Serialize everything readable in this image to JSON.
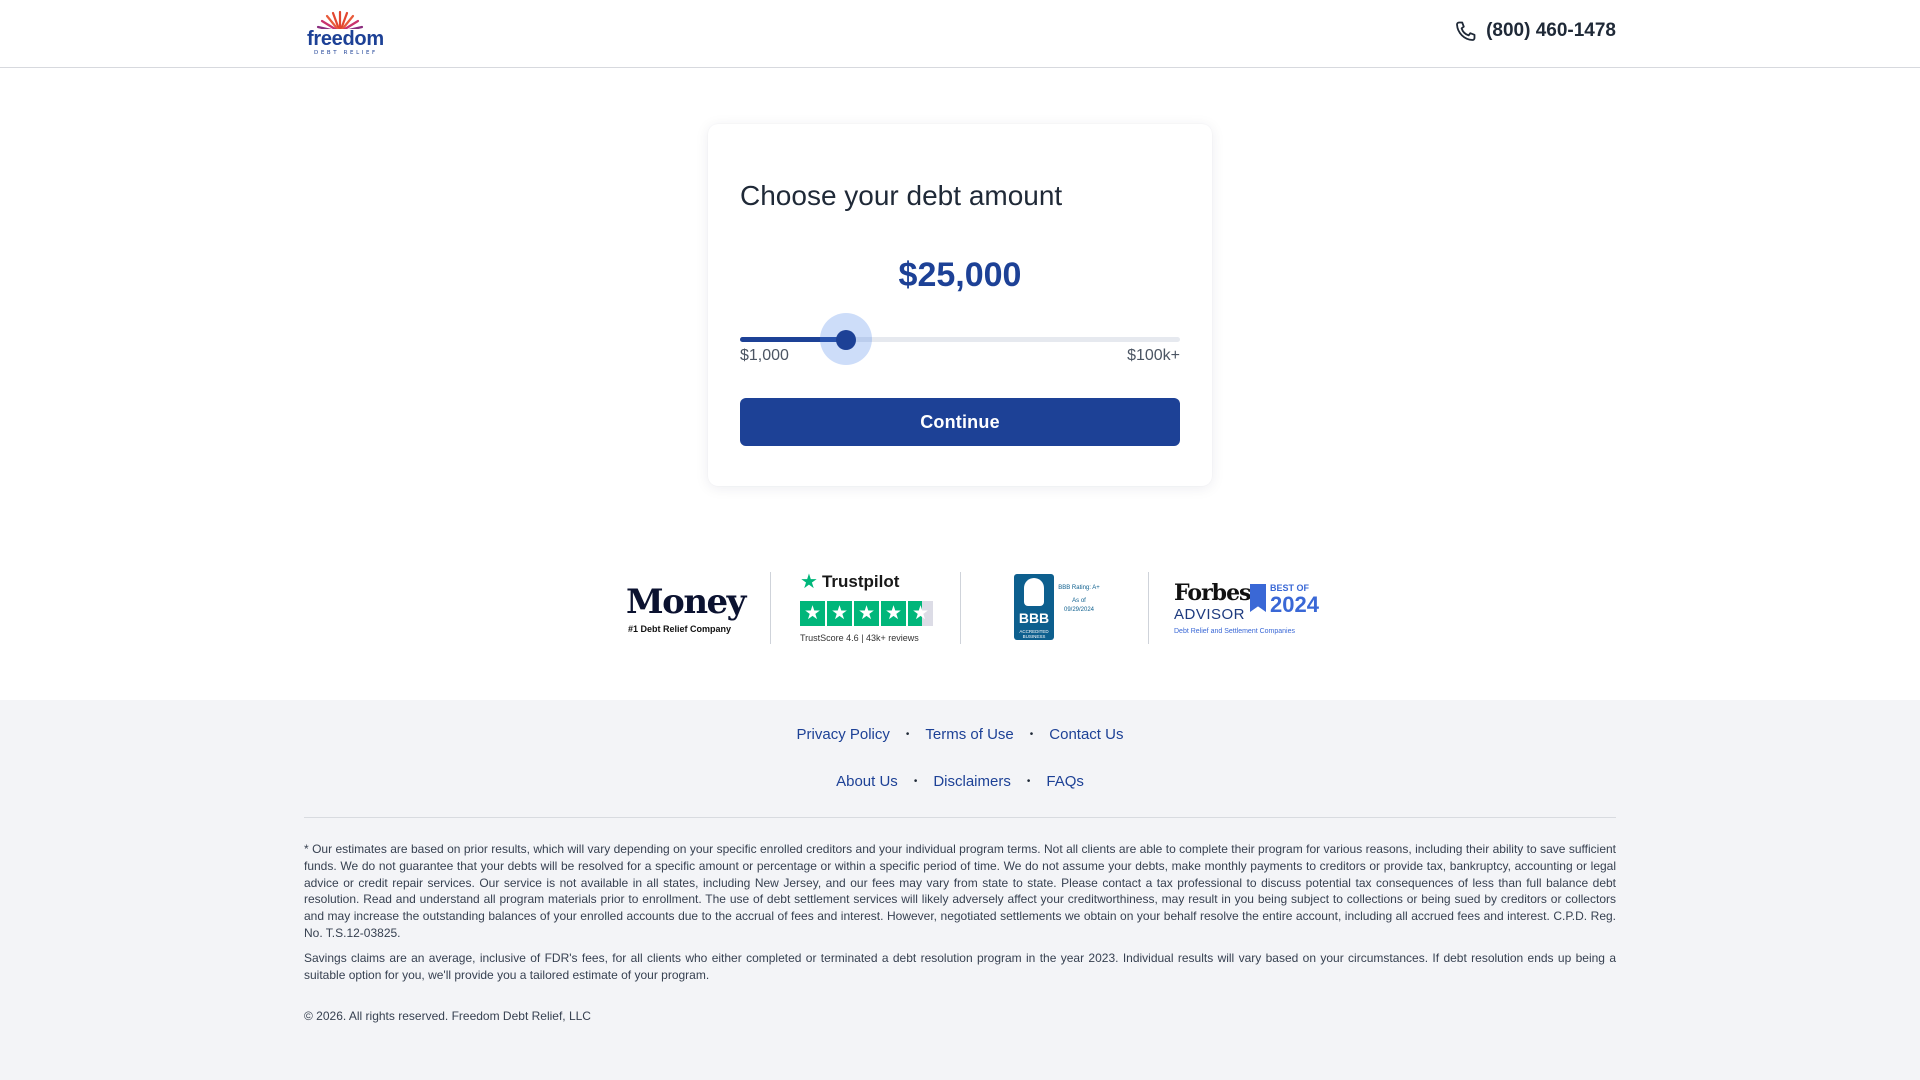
{
  "header": {
    "logo_word": "freedom",
    "logo_sub": "DEBT RELIEF",
    "phone": "(800) 460-1478"
  },
  "card": {
    "title": "Choose your debt amount",
    "amount_display": "$25,000",
    "slider": {
      "min_label": "$1,000",
      "max_label": "$100k+",
      "fraction": 0.242
    },
    "continue_label": "Continue"
  },
  "badges": {
    "money": {
      "title": "Money",
      "subtitle": "#1 Debt Relief Company"
    },
    "trustpilot": {
      "name": "Trustpilot",
      "score_text": "TrustScore 4.6 | 43k+ reviews",
      "stars": 4.6
    },
    "bbb": {
      "seal": "BBB",
      "accredited": "ACCREDITED BUSINESS",
      "rating_label": "BBB Rating: A+",
      "as_of": "As of 09/29/2024"
    },
    "forbes": {
      "brand": "Forbes",
      "advisor": "ADVISOR",
      "best_of": "BEST OF",
      "year": "2024",
      "category": "Debt Relief and Settlement Companies"
    }
  },
  "footer": {
    "links_row1": [
      "Privacy Policy",
      "Terms of Use",
      "Contact Us"
    ],
    "links_row2": [
      "About Us",
      "Disclaimers",
      "FAQs"
    ],
    "disclaimer_1": "* Our estimates are based on prior results, which will vary depending on your specific enrolled creditors and your individual program terms. Not all clients are able to complete their program for various reasons, including their ability to save sufficient funds. We do not guarantee that your debts will be resolved for a specific amount or percentage or within a specific period of time. We do not assume your debts, make monthly payments to creditors or provide tax, bankruptcy, accounting or legal advice or credit repair services. Our service is not available in all states, including New Jersey, and our fees may vary from state to state. Please contact a tax professional to discuss potential tax consequences of less than full balance debt resolution. Read and understand all program materials prior to enrollment. The use of debt settlement services will likely adversely affect your creditworthiness, may result in you being subject to collections or being sued by creditors or collectors and may increase the outstanding balances of your enrolled accounts due to the accrual of fees and interest. However, negotiated settlements we obtain on your behalf resolve the entire account, including all accrued fees and interest. C.P.D. Reg. No. T.S.12-03825.",
    "disclaimer_2": "Savings claims are an average, inclusive of FDR's fees, for all clients who either completed or terminated a debt resolution program in the year 2023. Individual results will vary based on your circumstances. If debt resolution ends up being a suitable option for you, we'll provide you a tailored estimate of your program.",
    "copyright": "© 2026. All rights reserved. Freedom Debt Relief, LLC"
  },
  "colors": {
    "brand_blue": "#1d4196",
    "slider_halo": "#4c86eb",
    "trustpilot_green": "#00b67a",
    "footer_bg": "#f3f4f7"
  },
  "icons": {
    "phone": "phone-icon",
    "trustpilot_star": "star-icon"
  }
}
